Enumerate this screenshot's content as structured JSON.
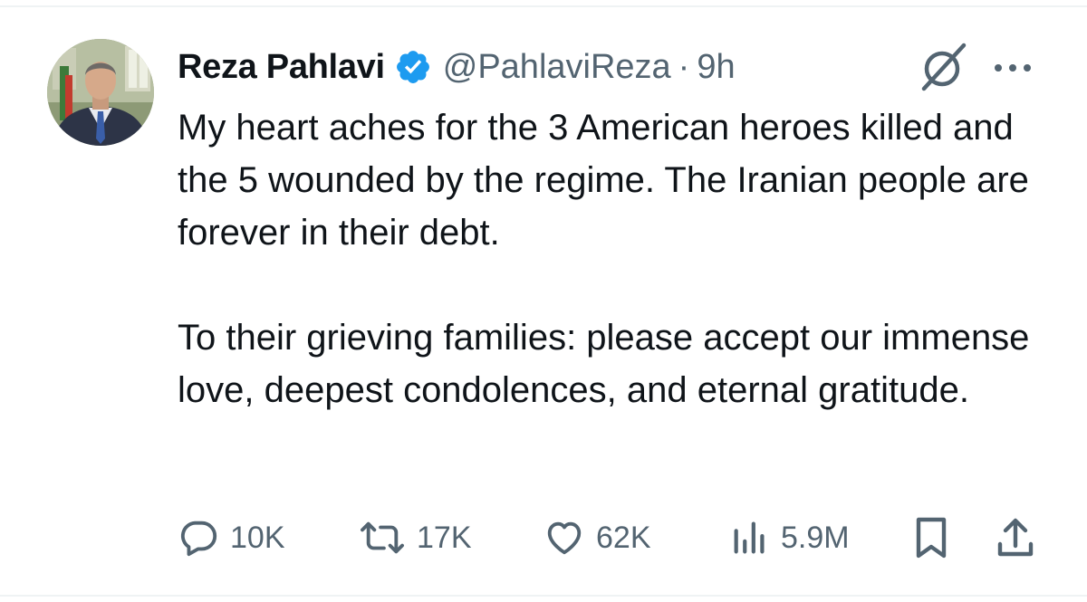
{
  "author": {
    "display_name": "Reza Pahlavi",
    "handle": "@PahlaviReza",
    "separator": "·",
    "time": "9h",
    "verified": true,
    "verified_color": "#1d9bf0"
  },
  "tweet": {
    "paragraphs": [
      "My heart aches for the 3 American heroes killed and the 5 wounded by the regime. The Iranian people are forever in their debt.",
      "To their grieving families: please accept our immense love, deepest condolences, and eternal gratitude."
    ]
  },
  "actions": {
    "replies": "10K",
    "reposts": "17K",
    "likes": "62K",
    "views": "5.9M"
  },
  "icons": {
    "reply": "speech-bubble-icon",
    "repost": "repost-arrows-icon",
    "like": "heart-icon",
    "views": "bar-chart-icon",
    "bookmark": "bookmark-icon",
    "share": "share-upload-icon",
    "grok": "grok-slash-circle-icon",
    "more": "more-dots-icon"
  },
  "colors": {
    "text": "#0f1419",
    "secondary": "#536471",
    "divider": "#eff3f4"
  }
}
